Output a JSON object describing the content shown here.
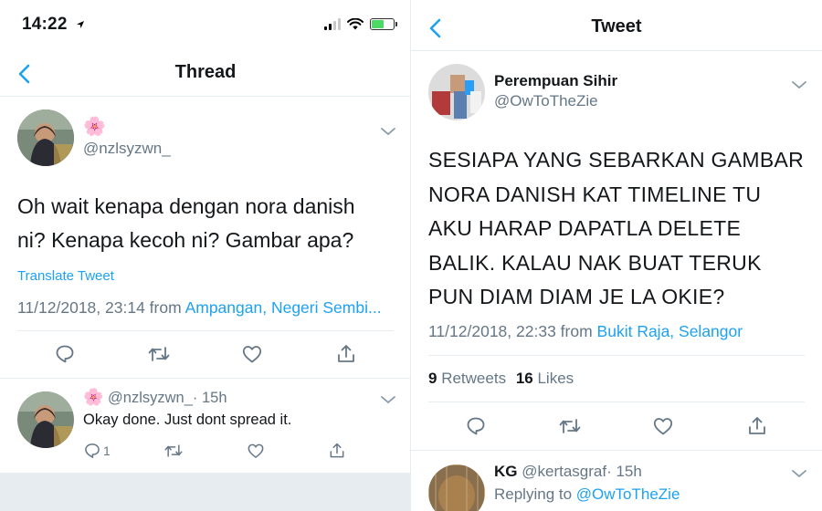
{
  "left": {
    "status": {
      "time": "14:22"
    },
    "nav": {
      "title": "Thread"
    },
    "main_tweet": {
      "emoji": "🌸",
      "handle": "@nzlsyzwn_",
      "text_line1": "Oh wait kenapa dengan nora danish",
      "text_line2": "ni? Kenapa kecoh ni? Gambar apa?",
      "translate": "Translate Tweet",
      "datetime": "11/12/2018, 23:14 from",
      "location": "Ampangan, Negeri Sembi..."
    },
    "reply": {
      "emoji": "🌸",
      "handle": "@nzlsyzwn_",
      "time": "· 15h",
      "text": "Okay done. Just dont spread it.",
      "reply_count": "1"
    }
  },
  "right": {
    "nav": {
      "title": "Tweet"
    },
    "tweet": {
      "name": "Perempuan Sihir",
      "handle": "@OwToTheZie",
      "lines": [
        "SESIAPA YANG SEBARKAN GAMBAR",
        "NORA DANISH KAT TIMELINE TU",
        "AKU HARAP DAPATLA DELETE",
        "BALIK. KALAU NAK BUAT TERUK",
        "PUN DIAM DIAM JE LA OKIE?"
      ],
      "datetime": "11/12/2018, 22:33 from",
      "location": "Bukit Raja, Selangor",
      "retweets_count": "9",
      "retweets_label": "Retweets",
      "likes_count": "16",
      "likes_label": "Likes"
    },
    "reply": {
      "name": "KG",
      "handle": "@kertasgraf",
      "time": "· 15h",
      "replying_prefix": "Replying to",
      "replying_to": "@OwToTheZie"
    }
  },
  "colors": {
    "accent": "#1da1f2",
    "muted": "#657786",
    "divider": "#e6ecf0",
    "text": "#14171a"
  }
}
